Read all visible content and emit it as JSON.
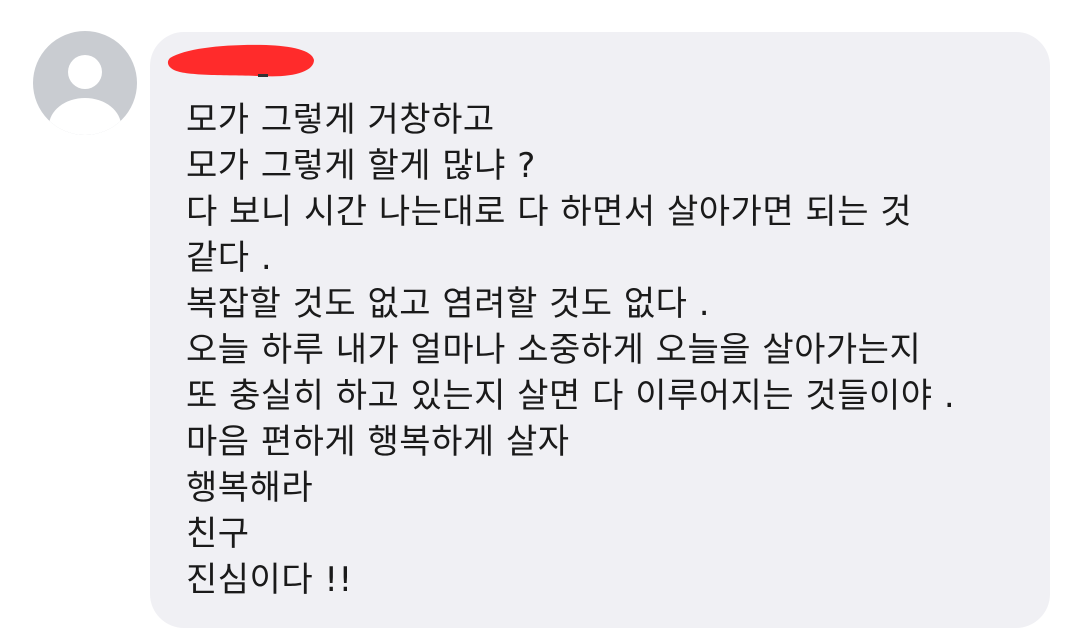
{
  "sender": {
    "avatar_icon": "default-user-icon",
    "name_redaction_color": "#ff2b2b"
  },
  "message": {
    "lines": [
      "모가 그렇게 거창하고",
      "모가 그렇게 할게 많냐 ?",
      "다 보니 시간 나는대로 다 하면서 살아가면 되는 것",
      "같다 .",
      "복잡할 것도 없고 염려할 것도 없다 .",
      "오늘 하루 내가 얼마나 소중하게 오늘을 살아가는지",
      "또 충실히 하고 있는지 살면 다 이루어지는 것들이야 .",
      "마음 편하게 행복하게 살자",
      "행복해라",
      "친구",
      "진심이다 !!"
    ]
  },
  "colors": {
    "bubble": "#f0f0f4",
    "avatar_bg": "#c9ccd1",
    "text": "#1a1a1a"
  }
}
